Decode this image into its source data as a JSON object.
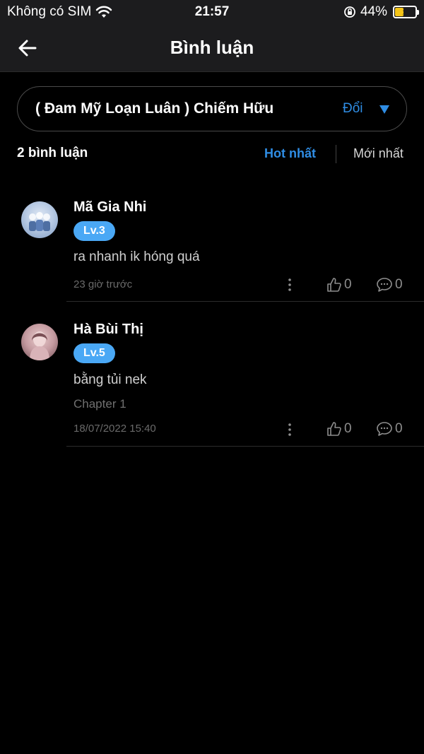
{
  "status_bar": {
    "carrier": "Không có SIM",
    "time": "21:57",
    "battery_percent": "44%",
    "battery_level": 0.44
  },
  "header": {
    "title": "Bình luận",
    "back_icon": "arrow-left-icon"
  },
  "book_selector": {
    "title": "( Đam Mỹ Loạn Luân ) Chiếm Hữu",
    "change_label": "Đổi",
    "dropdown_icon": "triangle-down-icon"
  },
  "sort_bar": {
    "count_label": "2 bình luận",
    "hot_label": "Hot nhất",
    "new_label": "Mới nhất",
    "active": "hot"
  },
  "comments": [
    {
      "username": "Mã Gia Nhi",
      "level": "Lv.3",
      "text": "ra nhanh ik hóng quá",
      "chapter": "",
      "time": "23 giờ trước",
      "likes": "0",
      "replies": "0"
    },
    {
      "username": "Hà Bùi Thị",
      "level": "Lv.5",
      "text": "bằng tủi nek",
      "chapter": "Chapter 1",
      "time": "18/07/2022 15:40",
      "likes": "0",
      "replies": "0"
    }
  ],
  "colors": {
    "accent": "#2f8de4",
    "badge": "#4aa8f5",
    "background": "#000000",
    "header": "#1c1c1e",
    "battery": "#f5c518"
  }
}
